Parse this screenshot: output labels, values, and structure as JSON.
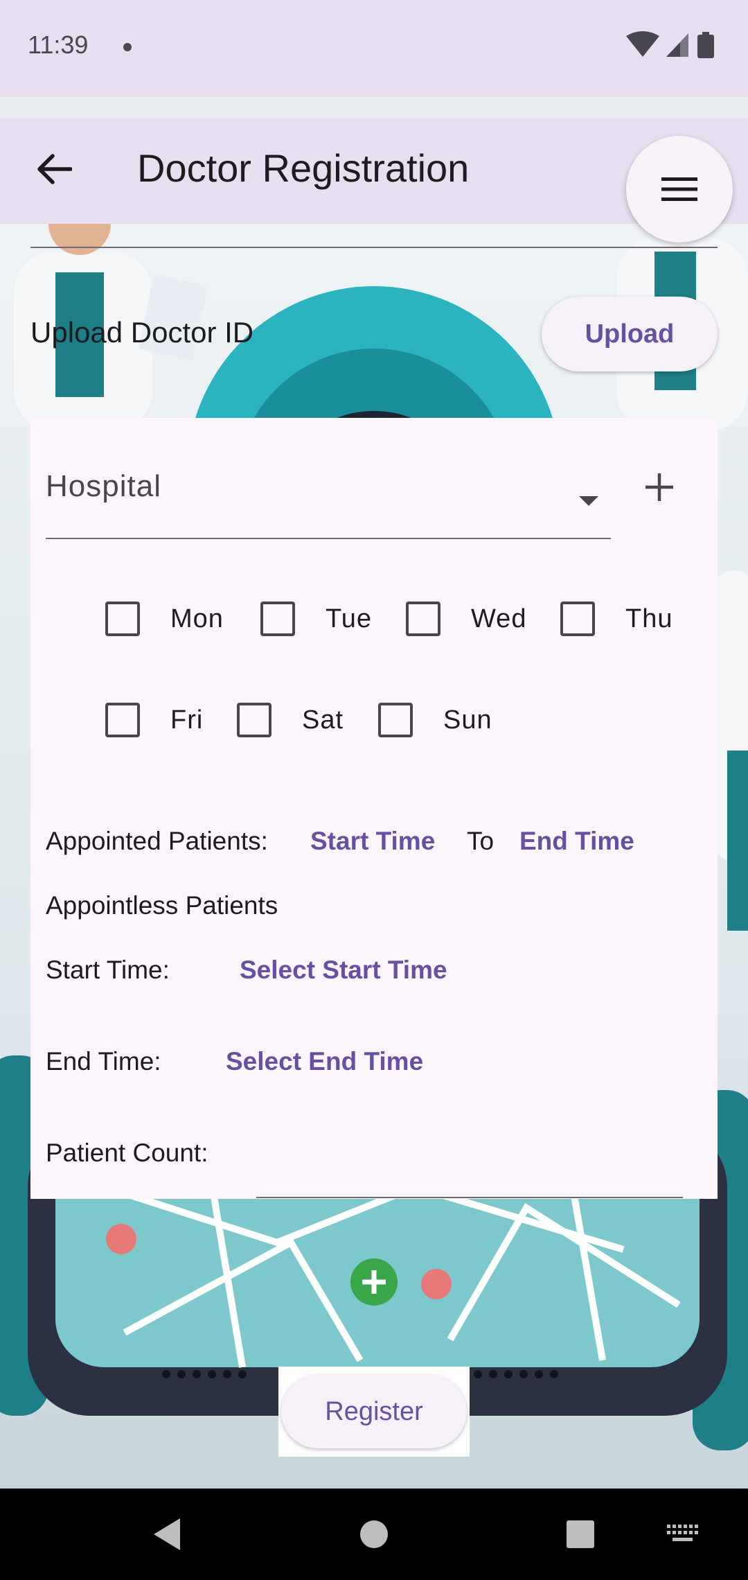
{
  "status_bar": {
    "time": "11:39"
  },
  "app_bar": {
    "title": "Doctor Registration"
  },
  "upload": {
    "label": "Upload Doctor ID",
    "button": "Upload"
  },
  "hospital": {
    "label": "Hospital"
  },
  "days": [
    "Mon",
    "Tue",
    "Wed",
    "Thu",
    "Fri",
    "Sat",
    "Sun"
  ],
  "appointed": {
    "label": "Appointed Patients:",
    "start": "Start Time",
    "to": "To",
    "end": "End Time"
  },
  "appointless": {
    "heading": "Appointless Patients",
    "start_label": "Start Time:",
    "start_value": "Select Start Time",
    "end_label": "End Time:",
    "end_value": "Select End Time",
    "count_label": "Patient Count:"
  },
  "register_button": "Register",
  "colors": {
    "accent": "#6750a4",
    "bar_bg": "#e7dff0",
    "card_bg": "#fcf5fb"
  }
}
